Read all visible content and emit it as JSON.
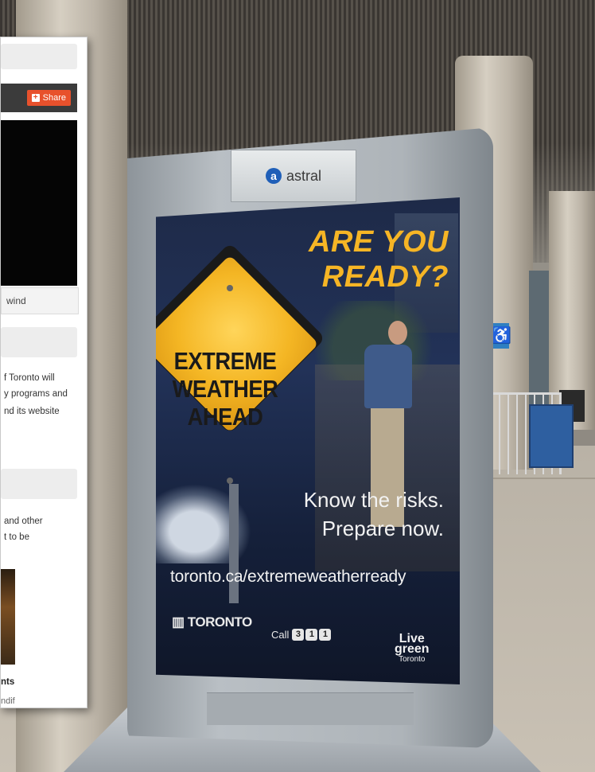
{
  "kiosk": {
    "brand": "astral"
  },
  "poster": {
    "headline_line1": "ARE YOU",
    "headline_line2": "READY?",
    "sign_line1": "EXTREME",
    "sign_line2": "WEATHER",
    "sign_line3": "AHEAD",
    "tagline_line1": "Know the risks.",
    "tagline_line2": "Prepare now.",
    "url": "toronto.ca/extremeweatherready",
    "logo_text": "TORONTO",
    "call_label": "Call",
    "call_digits": [
      "3",
      "1",
      "1"
    ],
    "live_line1": "Live",
    "live_line2": "green",
    "live_line3": "Toronto",
    "accent_color": "#f6b525"
  },
  "overlay_page": {
    "share_label": "Share",
    "video_control_text": "wind",
    "para1": [
      "f Toronto will",
      "y programs and",
      "nd its website"
    ],
    "para2": [
      "and other",
      "t to be"
    ],
    "thumb_caption": "nts",
    "thumb_caption2": "ndif"
  }
}
